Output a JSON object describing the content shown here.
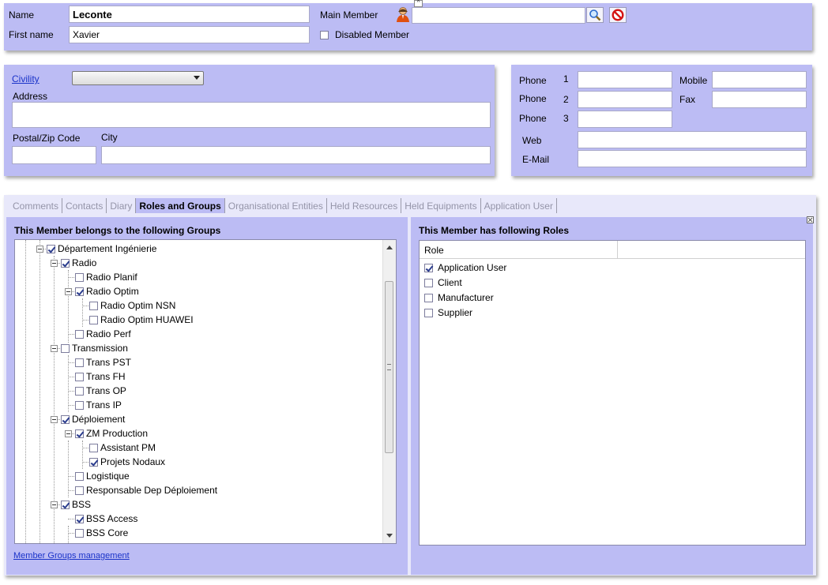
{
  "header": {
    "name_label": "Name",
    "name_value": "Leconte",
    "firstname_label": "First name",
    "firstname_value": "Xavier",
    "main_member_label": "Main Member",
    "main_member_value": "",
    "disabled_member_label": "Disabled Member",
    "disabled_member_checked": false
  },
  "address": {
    "civility_label": "Civility",
    "civility_value": "",
    "address_label": "Address",
    "address_value": "",
    "postal_label": "Postal/Zip Code",
    "postal_value": "",
    "city_label": "City",
    "city_value": ""
  },
  "contact": {
    "phone_label": "Phone",
    "phone1_num": "1",
    "phone2_num": "2",
    "phone3_num": "3",
    "mobile_label": "Mobile",
    "fax_label": "Fax",
    "web_label": "Web",
    "email_label": "E-Mail"
  },
  "tabs": [
    {
      "label": "Comments",
      "active": false
    },
    {
      "label": "Contacts",
      "active": false
    },
    {
      "label": "Diary",
      "active": false
    },
    {
      "label": "Roles and Groups",
      "active": true
    },
    {
      "label": "Organisational Entities",
      "active": false
    },
    {
      "label": "Held Resources",
      "active": false
    },
    {
      "label": "Held Equipments",
      "active": false
    },
    {
      "label": "Application User",
      "active": false
    }
  ],
  "groups": {
    "title": "This Member belongs to the following Groups",
    "management_link": "Member Groups management",
    "tree": [
      {
        "label": "Département Ingénierie",
        "level": 0,
        "checked": true,
        "expander": true
      },
      {
        "label": "Radio",
        "level": 1,
        "checked": true,
        "expander": true
      },
      {
        "label": "Radio Planif",
        "level": 2,
        "checked": false,
        "expander": false
      },
      {
        "label": "Radio Optim",
        "level": 2,
        "checked": true,
        "expander": true
      },
      {
        "label": "Radio Optim NSN",
        "level": 3,
        "checked": false,
        "expander": false
      },
      {
        "label": "Radio Optim HUAWEI",
        "level": 3,
        "checked": false,
        "expander": false
      },
      {
        "label": "Radio Perf",
        "level": 2,
        "checked": false,
        "expander": false
      },
      {
        "label": "Transmission",
        "level": 1,
        "checked": false,
        "expander": true
      },
      {
        "label": "Trans PST",
        "level": 2,
        "checked": false,
        "expander": false
      },
      {
        "label": "Trans FH",
        "level": 2,
        "checked": false,
        "expander": false
      },
      {
        "label": "Trans OP",
        "level": 2,
        "checked": false,
        "expander": false
      },
      {
        "label": "Trans IP",
        "level": 2,
        "checked": false,
        "expander": false
      },
      {
        "label": "Déploiement",
        "level": 1,
        "checked": true,
        "expander": true
      },
      {
        "label": "ZM Production",
        "level": 2,
        "checked": true,
        "expander": true
      },
      {
        "label": "Assistant PM",
        "level": 3,
        "checked": false,
        "expander": false
      },
      {
        "label": "Projets Nodaux",
        "level": 3,
        "checked": true,
        "expander": false
      },
      {
        "label": "Logistique",
        "level": 2,
        "checked": false,
        "expander": false
      },
      {
        "label": "Responsable Dep Déploiement",
        "level": 2,
        "checked": false,
        "expander": false
      },
      {
        "label": "BSS",
        "level": 1,
        "checked": true,
        "expander": true
      },
      {
        "label": "BSS Access",
        "level": 2,
        "checked": true,
        "expander": false
      },
      {
        "label": "BSS Core",
        "level": 2,
        "checked": false,
        "expander": false
      }
    ]
  },
  "roles": {
    "title": "This Member has following Roles",
    "column_header": "Role",
    "items": [
      {
        "label": "Application User",
        "checked": true
      },
      {
        "label": "Client",
        "checked": false
      },
      {
        "label": "Manufacturer",
        "checked": false
      },
      {
        "label": "Supplier",
        "checked": false
      }
    ]
  },
  "colors": {
    "panel": "#bcbcf4",
    "link": "#1a33c9"
  }
}
